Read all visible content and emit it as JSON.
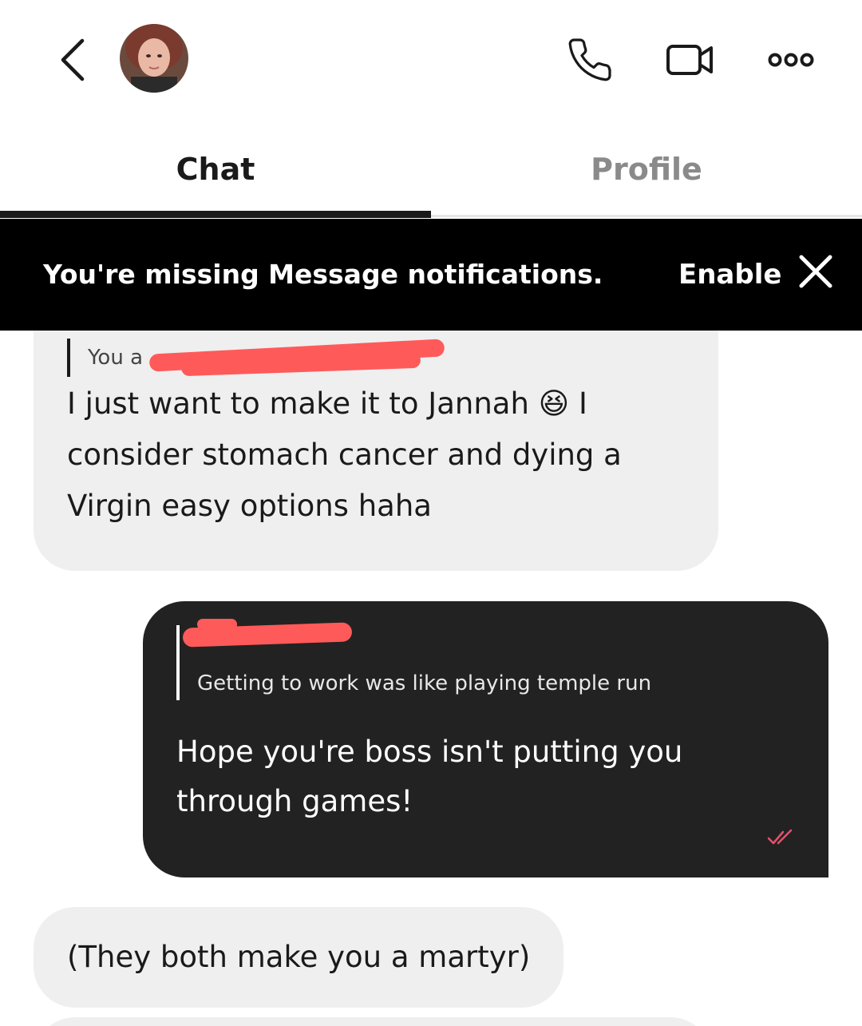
{
  "header": {
    "contact_name": "",
    "back_icon": "chevron-left-icon",
    "call_icon": "phone-icon",
    "video_icon": "video-camera-icon",
    "more_icon": "more-options-icon"
  },
  "tabs": [
    {
      "label": "Chat",
      "active": true
    },
    {
      "label": "Profile",
      "active": false
    }
  ],
  "banner": {
    "text": "You're missing Message notifications.",
    "action_label": "Enable",
    "close_icon": "close-icon"
  },
  "messages": [
    {
      "direction": "incoming",
      "quote_text": "You a",
      "text": "I just want to make it to Jannah 😆 I consider stomach cancer and dying a Virgin easy options haha"
    },
    {
      "direction": "outgoing",
      "quote_name": "",
      "quote_text": "Getting to work was like playing temple run",
      "text": "Hope you're boss isn't putting you through games!",
      "status_icon": "double-check-icon"
    },
    {
      "direction": "incoming",
      "text": "(They both make you a martyr)"
    }
  ],
  "colors": {
    "accent": "#ff5a5a",
    "outgoing_bubble": "#222222",
    "incoming_bubble": "#efefef",
    "read_tick": "#e8516b"
  }
}
